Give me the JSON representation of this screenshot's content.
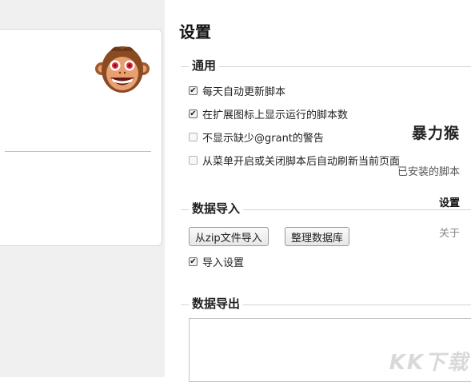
{
  "sidebar": {
    "brand": "暴力猴",
    "items": [
      {
        "label": "已安装的脚本"
      },
      {
        "label": "设置"
      },
      {
        "label": "关于"
      }
    ]
  },
  "main": {
    "title": "设置",
    "general": {
      "label": "通用",
      "options": [
        {
          "label": "每天自动更新脚本",
          "checked": true
        },
        {
          "label": "在扩展图标上显示运行的脚本数",
          "checked": true
        },
        {
          "label": "不显示缺少@grant的警告",
          "checked": false
        },
        {
          "label": "从菜单开启或关闭脚本后自动刷新当前页面",
          "checked": false
        }
      ]
    },
    "import": {
      "label": "数据导入",
      "zip_button": "从zip文件导入",
      "vacuum_button": "整理数据库",
      "import_settings_label": "导入设置",
      "import_settings_checked": true
    },
    "export": {
      "label": "数据导出"
    }
  },
  "watermark": "KK下载",
  "colors": {
    "sidebar_bg": "#f0f0f0",
    "monkey_face": "#e8a070",
    "monkey_fur": "#8a4b23"
  }
}
